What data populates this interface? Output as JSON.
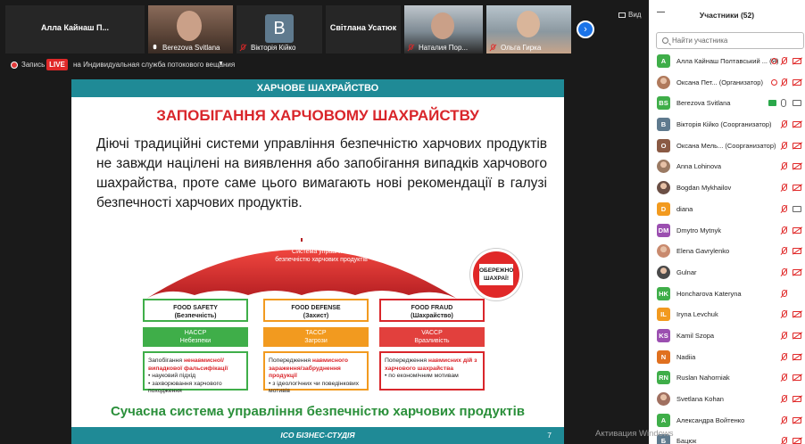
{
  "video_strip": {
    "tiles": [
      {
        "name": "Алла Кайнаш П..."
      },
      {
        "name": "Berezova Svitlana"
      },
      {
        "name": "Вікторія Кійко",
        "avatar_letter": "B"
      },
      {
        "name": "Світлана Усатюк"
      },
      {
        "name": "Наталия Пор..."
      },
      {
        "name": "Ольга Гирка"
      }
    ],
    "view_label": "Вид"
  },
  "recording_bar": {
    "record_label": "Запись",
    "live_label": "LIVE",
    "stream_label": "на Индивидуальная служба потокового вещания"
  },
  "slide": {
    "header": "ХАРЧОВЕ ШАХРАЙСТВО",
    "title": "ЗАПОБІГАННЯ ХАРЧОВОМУ ШАХРАЙСТВУ",
    "body": "Діючі традиційні системи управління безпечністю харчових продуктів не завжди націлені на виявлення або запобігання випадків харчового шахрайства, проте саме цього вимагають нові рекомендації в галузі безпечності харчових продуктів.",
    "umbrella_text": "Система управління безпечністю харчових продуктів",
    "warning": "ОБЕРЕЖНО ШАХРАЇ!",
    "columns": [
      {
        "title": "FOOD SAFETY",
        "subtitle": "(Безпечність)",
        "hazard_code": "HACCP",
        "hazard_name": "Небезпеки",
        "desc_prefix": "Запобігання ",
        "desc_highlight": "ненавмисної/ випадкової фальсифікації",
        "bullets": [
          "науковий підхід",
          "захворювання харчового походження"
        ],
        "border_color": "#3fae49",
        "fill_color": "#3fae49"
      },
      {
        "title": "FOOD DEFENSE",
        "subtitle": "(Захист)",
        "hazard_code": "TACCP",
        "hazard_name": "Загрози",
        "desc_prefix": "Попередження ",
        "desc_highlight": "навмисного зараження/забруднення продукції",
        "bullets": [
          "з ідеологічних чи поведінкових мотивів"
        ],
        "border_color": "#f29a1f",
        "fill_color": "#f29a1f"
      },
      {
        "title": "FOOD FRAUD",
        "subtitle": "(Шахрайство)",
        "hazard_code": "VACCP",
        "hazard_name": "Вразливість",
        "desc_prefix": "Попередження ",
        "desc_highlight": "навмисних дій з харчового шахрайства",
        "bullets": [
          "по економічним мотивам"
        ],
        "border_color": "#d9262b",
        "fill_color": "#e2403d"
      }
    ],
    "bottom_text": "Сучасна система управління безпечністю харчових продуктів",
    "footer_brand": "ІСО БІЗНЕС-СТУДІЯ",
    "page_number": "7"
  },
  "participants": {
    "title": "Участники (52)",
    "search_placeholder": "Найти участника",
    "list": [
      {
        "initials": "A",
        "name": "Алла Кайнаш Полтавський ... (Я)",
        "color": "#3fae49",
        "photo": false,
        "icons": "rec"
      },
      {
        "initials": "",
        "name": "Оксана Пет... (Организатор)",
        "color": "#b07a5c",
        "photo": true,
        "icons": "rec"
      },
      {
        "initials": "BS",
        "name": "Berezova Svitlana",
        "color": "#3fae49",
        "photo": false,
        "icons": "screen-on"
      },
      {
        "initials": "B",
        "name": "Вікторія Кійко (Соорганизатор)",
        "color": "#5f7a8e",
        "photo": false,
        "icons": "off"
      },
      {
        "initials": "O",
        "name": "Оксана Мель... (Соорганизатор)",
        "color": "#8a5a44",
        "photo": false,
        "icons": "off"
      },
      {
        "initials": "",
        "name": "Anna Lohinova",
        "color": "#9b7a63",
        "photo": true,
        "icons": "off"
      },
      {
        "initials": "",
        "name": "Bogdan Mykhailov",
        "color": "#6b4f45",
        "photo": true,
        "icons": "off"
      },
      {
        "initials": "D",
        "name": "diana",
        "color": "#f29a1f",
        "photo": false,
        "icons": "cam"
      },
      {
        "initials": "DM",
        "name": "Dmytro Mytnyk",
        "color": "#9b4fb0",
        "photo": false,
        "icons": "off"
      },
      {
        "initials": "",
        "name": "Elena Gavrylenko",
        "color": "#c98a6e",
        "photo": true,
        "icons": "off"
      },
      {
        "initials": "",
        "name": "Gulnar",
        "color": "#4a4a4a",
        "photo": true,
        "icons": "off"
      },
      {
        "initials": "HK",
        "name": "Honcharova Kateryna",
        "color": "#3fae49",
        "photo": false,
        "icons": "mic"
      },
      {
        "initials": "IL",
        "name": "Iryna Levchuk",
        "color": "#f29a1f",
        "photo": false,
        "icons": "off"
      },
      {
        "initials": "KS",
        "name": "Kamil Szopa",
        "color": "#9b4fb0",
        "photo": false,
        "icons": "off"
      },
      {
        "initials": "N",
        "name": "Nadiia",
        "color": "#e0701f",
        "photo": false,
        "icons": "off"
      },
      {
        "initials": "RN",
        "name": "Ruslan Nahorniak",
        "color": "#3fae49",
        "photo": false,
        "icons": "off"
      },
      {
        "initials": "",
        "name": "Svetlana Kohan",
        "color": "#a07060",
        "photo": true,
        "icons": "off"
      },
      {
        "initials": "A",
        "name": "Александра Войтенко",
        "color": "#3fae49",
        "photo": false,
        "icons": "off"
      },
      {
        "initials": "Б",
        "name": "Бацюк",
        "color": "#5f7a8e",
        "photo": false,
        "icons": "off"
      }
    ]
  },
  "system": {
    "activation_text": "Активация Windows"
  }
}
